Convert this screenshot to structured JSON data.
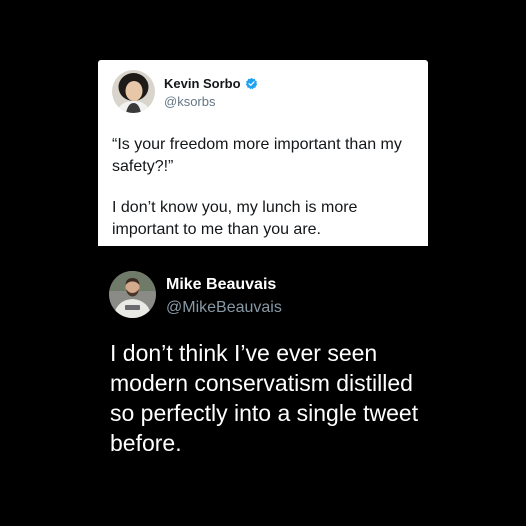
{
  "quoted_tweet": {
    "author": {
      "name": "Kevin Sorbo",
      "handle": "@ksorbs",
      "verified": true,
      "verified_color": "#1da1f2"
    },
    "text_line_1": "“Is your freedom more important than my safety?!”",
    "text_line_2": "I don’t know you, my lunch is more important to me than you are.",
    "background": "#ffffff"
  },
  "main_tweet": {
    "author": {
      "name": "Mike Beauvais",
      "handle": "@MikeBeauvais"
    },
    "text": "I don’t think I’ve ever seen modern conservatism distilled so perfectly into a single tweet before.",
    "background": "#000000"
  }
}
